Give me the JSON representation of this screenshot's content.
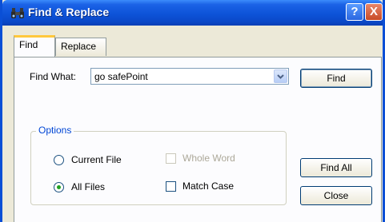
{
  "window": {
    "title": "Find & Replace",
    "help_label": "?",
    "close_label": "X",
    "title_bar_color": "#0a4fd6"
  },
  "tabs": [
    {
      "label": "Find",
      "active": true
    },
    {
      "label": "Replace",
      "active": false
    }
  ],
  "find_what": {
    "label": "Find What:",
    "value": "go safePoint"
  },
  "options": {
    "legend": "Options",
    "current_file_label": "Current File",
    "all_files_label": "All Files",
    "selected_scope": "All Files",
    "whole_word_label": "Whole Word",
    "whole_word_enabled": false,
    "match_case_label": "Match Case",
    "match_case_checked": false
  },
  "buttons": {
    "find_label": "Find",
    "find_all_label": "Find All",
    "close_label": "Close"
  }
}
